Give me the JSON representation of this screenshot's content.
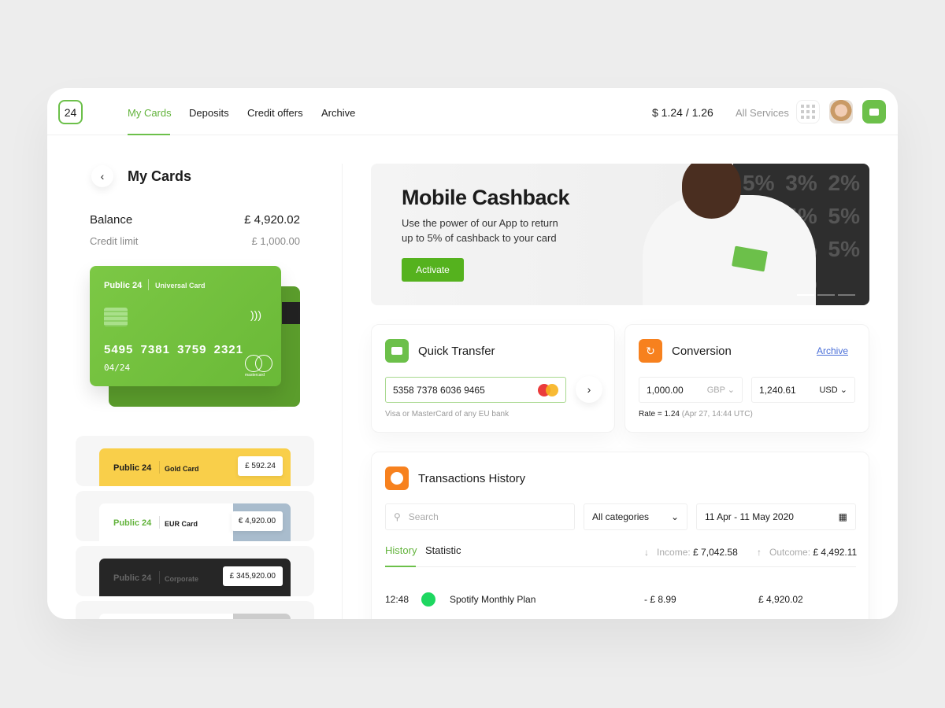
{
  "header": {
    "logo": "24",
    "nav": [
      "My Cards",
      "Deposits",
      "Credit offers",
      "Archive"
    ],
    "active_nav": "My Cards",
    "rate": "$ 1.24 / 1.26",
    "all_services": "All Services"
  },
  "left": {
    "back_icon": "chevron-left",
    "title": "My Cards",
    "balance_label": "Balance",
    "balance": "£ 4,920.02",
    "credit_label": "Credit limit",
    "credit": "£ 1,000.00",
    "main_card": {
      "brand": "Public 24",
      "type": "Universal Card",
      "number": "5495 7381 3759 2321",
      "expiry": "04/24",
      "network": "mastercard"
    },
    "cards": [
      {
        "brand": "Public 24",
        "type": "Gold Card",
        "amount": "£ 592.24",
        "color": "#f9cf4a"
      },
      {
        "brand": "Public 24",
        "type": "EUR Card",
        "amount": "€ 4,920.00",
        "color": "#ffffff"
      },
      {
        "brand": "Public 24",
        "type": "Corporate",
        "amount": "£ 345,920.00",
        "color": "#262626"
      }
    ]
  },
  "banner": {
    "title": "Mobile Cashback",
    "text": "Use the power of our App to return up to 5% of cashback to your card",
    "button": "Activate",
    "slides": 3,
    "active_slide": 1
  },
  "quick_transfer": {
    "title": "Quick Transfer",
    "card_number": "5358 7378 6036 9465",
    "hint": "Visa or MasterCard of any EU bank"
  },
  "conversion": {
    "title": "Conversion",
    "archive": "Archive",
    "from_amount": "1,000.00",
    "from_currency": "GBP",
    "to_amount": "1,240.61",
    "to_currency": "USD",
    "rate": "Rate = 1.24",
    "rate_time": "(Apr 27, 14:44 UTC)"
  },
  "transactions": {
    "title": "Transactions History",
    "search_placeholder": "Search",
    "category": "All categories",
    "date_range": "11 Apr - 11 May 2020",
    "tabs": [
      "History",
      "Statistic"
    ],
    "income_label": "Income:",
    "income": "£ 7,042.58",
    "outcome_label": "Outcome:",
    "outcome": "£ 4,492.11",
    "rows": [
      {
        "time": "12:48",
        "name": "Spotify Monthly Plan",
        "amount": "- £ 8.99",
        "balance": "£ 4,920.02"
      }
    ]
  },
  "colors": {
    "accent": "#6cc04a",
    "orange": "#f7811e",
    "link": "#4a6fd8"
  }
}
